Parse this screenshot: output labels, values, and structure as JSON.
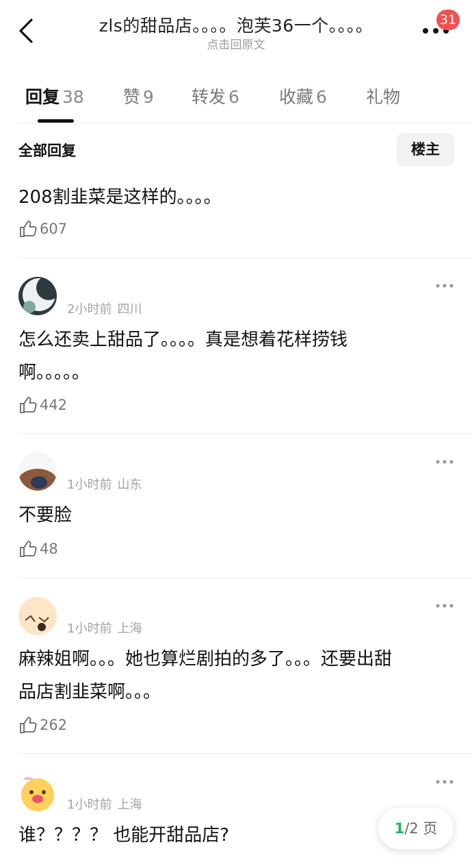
{
  "header": {
    "title": "zls的甜品店。。。。泡芙36一个。。。。",
    "subtitle": "点击回原文",
    "notification_count": "31"
  },
  "tabs": [
    {
      "label": "回复",
      "count": "38",
      "active": true
    },
    {
      "label": "赞",
      "count": "9"
    },
    {
      "label": "转发",
      "count": "6"
    },
    {
      "label": "收藏",
      "count": "6"
    },
    {
      "label": "礼物",
      "count": ""
    }
  ],
  "section": {
    "all_replies_label": "全部回复",
    "floor_button": "楼主"
  },
  "top_comment": {
    "text": "208割韭菜是这样的。。。。",
    "likes": "607"
  },
  "comments": [
    {
      "time": "2小时前",
      "location": "四川",
      "lines": [
        "怎么还卖上甜品了。。。。真是想着花样捞钱",
        "啊。。。。。"
      ],
      "likes": "442"
    },
    {
      "time": "1小时前",
      "location": "山东",
      "lines": [
        "不要脸"
      ],
      "likes": "48"
    },
    {
      "time": "1小时前",
      "location": "上海",
      "lines": [
        "麻辣姐啊。。。她也算烂剧拍的多了。。。还要出甜",
        "品店割韭菜啊。。。"
      ],
      "likes": "262"
    },
    {
      "time": "1小时前",
      "location": "上海",
      "lines": [
        "谁？？？？ 也能开甜品店?"
      ],
      "likes": ""
    }
  ],
  "pager": {
    "current": "1",
    "total_label": "/2 页"
  },
  "icons": [
    "back-icon",
    "more-icon",
    "thumbs-up-icon"
  ],
  "colors": {
    "badge": "#f2514f",
    "pager_current": "#20b35a",
    "meta_text": "#a3a3a3"
  }
}
